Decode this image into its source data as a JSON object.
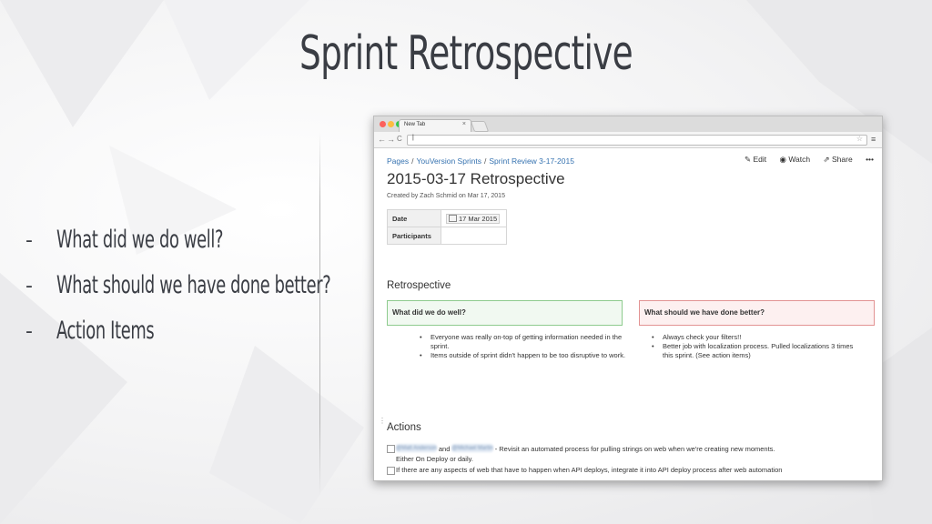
{
  "slide": {
    "title": "Sprint Retrospective",
    "bullets": [
      {
        "dash": "-",
        "text": "What did we do well?"
      },
      {
        "dash": "-",
        "text": "What should we have done better?"
      },
      {
        "dash": "-",
        "text": "Action Items"
      }
    ]
  },
  "browser": {
    "tab_label": "New Tab",
    "tab_close": "×",
    "address_value": "|",
    "nav": {
      "back": "←",
      "forward": "→",
      "reload": "C"
    },
    "star": "☆",
    "menu_icon": "≡"
  },
  "page": {
    "breadcrumb": [
      "Pages",
      "YouVersion Sprints",
      "Sprint Review 3-17-2015"
    ],
    "breadcrumb_sep": "/",
    "actions": {
      "edit": "Edit",
      "watch": "Watch",
      "share": "Share",
      "more": "•••"
    },
    "title": "2015-03-17 Retrospective",
    "byline": "Created by Zach Schmid on Mar 17, 2015",
    "meta": {
      "date_label": "Date",
      "date_value": "17 Mar 2015",
      "participants_label": "Participants",
      "participants_value": ""
    },
    "retro_heading": "Retrospective",
    "good_title": "What did we do well?",
    "bad_title": "What should we have done better?",
    "good_items": [
      "Everyone was really on-top of getting information needed in the sprint.",
      "Items outside of sprint didn't happen to be too disruptive to work."
    ],
    "bad_items": [
      "Always check your filters!!",
      "Better job with localization process. Pulled localizations 3 times this sprint. (See action items)"
    ],
    "actions_heading": "Actions",
    "action_items": {
      "first_mention_a": "@Matt Anderson",
      "first_and": "and",
      "first_mention_b": "@Michael Martin",
      "first_text": "- Revisit an automated process for pulling strings on web when we're creating new moments.",
      "first_text_2": "Either On Deploy or daily.",
      "second_text": "If there are any aspects of web that have to happen when API deploys, integrate it into API deploy process after web automation"
    },
    "colors": {
      "link": "#3572b0",
      "good_border": "#8ecb8e",
      "bad_border": "#e29393"
    }
  }
}
